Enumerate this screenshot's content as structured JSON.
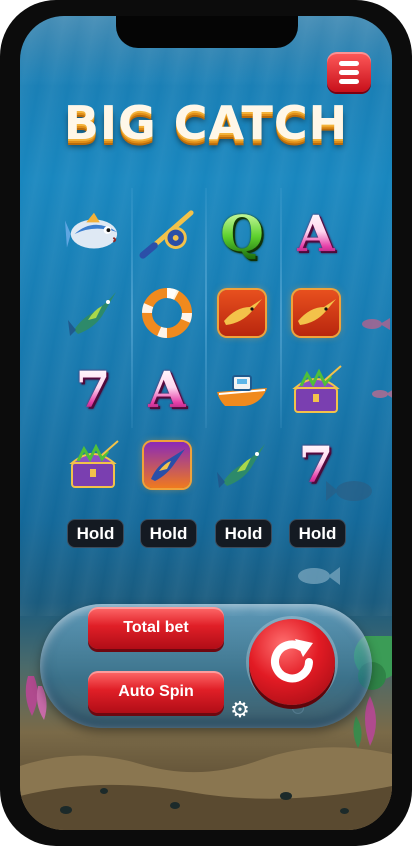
{
  "game": {
    "title": "BIG CATCH"
  },
  "reels": [
    [
      "fish-icon",
      "marlin-icon",
      "seven-symbol",
      "treasure-chest-icon"
    ],
    [
      "fishing-rod-icon",
      "life-ring-icon",
      "A",
      "marlin-tile-icon"
    ],
    [
      "Q",
      "marlin-tile-icon",
      "boat-icon",
      "marlin-icon"
    ],
    [
      "A",
      "marlin-tile-icon",
      "treasure-chest-icon",
      "seven-symbol"
    ]
  ],
  "symbols": {
    "seven": "7",
    "A": "A",
    "Q": "Q"
  },
  "hold_buttons": [
    "Hold",
    "Hold",
    "Hold",
    "Hold"
  ],
  "controls": {
    "total_bet_label": "Total bet",
    "auto_spin_label": "Auto Spin"
  },
  "colors": {
    "accent_red": "#e01f27",
    "water": "#1987bf",
    "title_gold": "#e08d17"
  }
}
